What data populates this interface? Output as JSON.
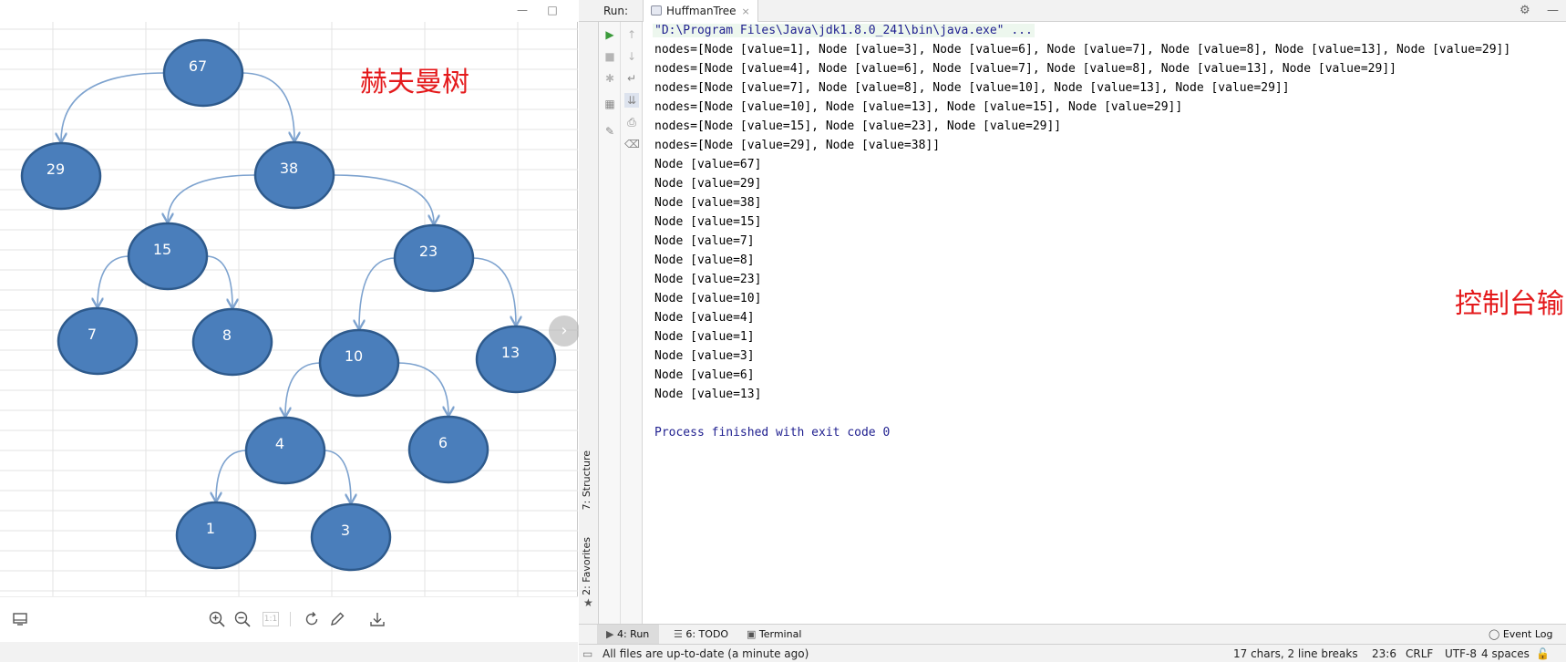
{
  "viewer": {
    "window_buttons": {
      "minimize": "—",
      "maximize": "□"
    },
    "title_annotation": "赫夫曼树",
    "tree": {
      "nodes": [
        {
          "id": "n67",
          "label": "67"
        },
        {
          "id": "n29",
          "label": "29"
        },
        {
          "id": "n38",
          "label": "38"
        },
        {
          "id": "n15",
          "label": "15"
        },
        {
          "id": "n23",
          "label": "23"
        },
        {
          "id": "n7",
          "label": "7"
        },
        {
          "id": "n8",
          "label": "8"
        },
        {
          "id": "n10",
          "label": "10"
        },
        {
          "id": "n13",
          "label": "13"
        },
        {
          "id": "n4",
          "label": "4"
        },
        {
          "id": "n6",
          "label": "6"
        },
        {
          "id": "n1",
          "label": "1"
        },
        {
          "id": "n3",
          "label": "3"
        }
      ],
      "edges": [
        [
          "n67",
          "n29"
        ],
        [
          "n67",
          "n38"
        ],
        [
          "n38",
          "n15"
        ],
        [
          "n38",
          "n23"
        ],
        [
          "n15",
          "n7"
        ],
        [
          "n15",
          "n8"
        ],
        [
          "n23",
          "n10"
        ],
        [
          "n23",
          "n13"
        ],
        [
          "n10",
          "n4"
        ],
        [
          "n10",
          "n6"
        ],
        [
          "n4",
          "n1"
        ],
        [
          "n4",
          "n3"
        ]
      ],
      "node_fill": "#4a7ebb",
      "node_stroke": "#2e5a8c",
      "edge_color": "#7ea3cf"
    },
    "toolbar": {
      "page_badge": "1:1",
      "icons": [
        "screen-icon",
        "zoom-in-icon",
        "zoom-out-icon",
        "rotate-icon",
        "edit-icon",
        "download-icon"
      ]
    },
    "next_arrow": "›"
  },
  "ide": {
    "run_label": "Run:",
    "tab_label": "HuffmanTree",
    "tab_close": "×",
    "settings_glyph": "⚙",
    "minimize_glyph": "—",
    "side_labels": {
      "structure": "7: Structure",
      "favorites": "2: Favorites"
    },
    "console": {
      "lines": [
        "\"D:\\Program Files\\Java\\jdk1.8.0_241\\bin\\java.exe\" ...",
        "nodes=[Node [value=1], Node [value=3], Node [value=6], Node [value=7], Node [value=8], Node [value=13], Node [value=29]]",
        "nodes=[Node [value=4], Node [value=6], Node [value=7], Node [value=8], Node [value=13], Node [value=29]]",
        "nodes=[Node [value=7], Node [value=8], Node [value=10], Node [value=13], Node [value=29]]",
        "nodes=[Node [value=10], Node [value=13], Node [value=15], Node [value=29]]",
        "nodes=[Node [value=15], Node [value=23], Node [value=29]]",
        "nodes=[Node [value=29], Node [value=38]]",
        "Node [value=67]",
        "Node [value=29]",
        "Node [value=38]",
        "Node [value=15]",
        "Node [value=7]",
        "Node [value=8]",
        "Node [value=23]",
        "Node [value=10]",
        "Node [value=4]",
        "Node [value=1]",
        "Node [value=3]",
        "Node [value=6]",
        "Node [value=13]",
        "",
        "Process finished with exit code 0"
      ],
      "annotation": "控制台输出结果与手动构建的赫夫曼树一致，yes!"
    },
    "bottom_tabs": {
      "run": "4: Run",
      "todo": "6: TODO",
      "terminal": "Terminal",
      "event_log": "Event Log"
    },
    "status": {
      "message": "All files are up-to-date (a minute ago)",
      "selection": "17 chars, 2 line breaks",
      "position": "23:6",
      "line_sep": "CRLF",
      "encoding": "UTF-8",
      "indent": "4 spaces"
    }
  }
}
